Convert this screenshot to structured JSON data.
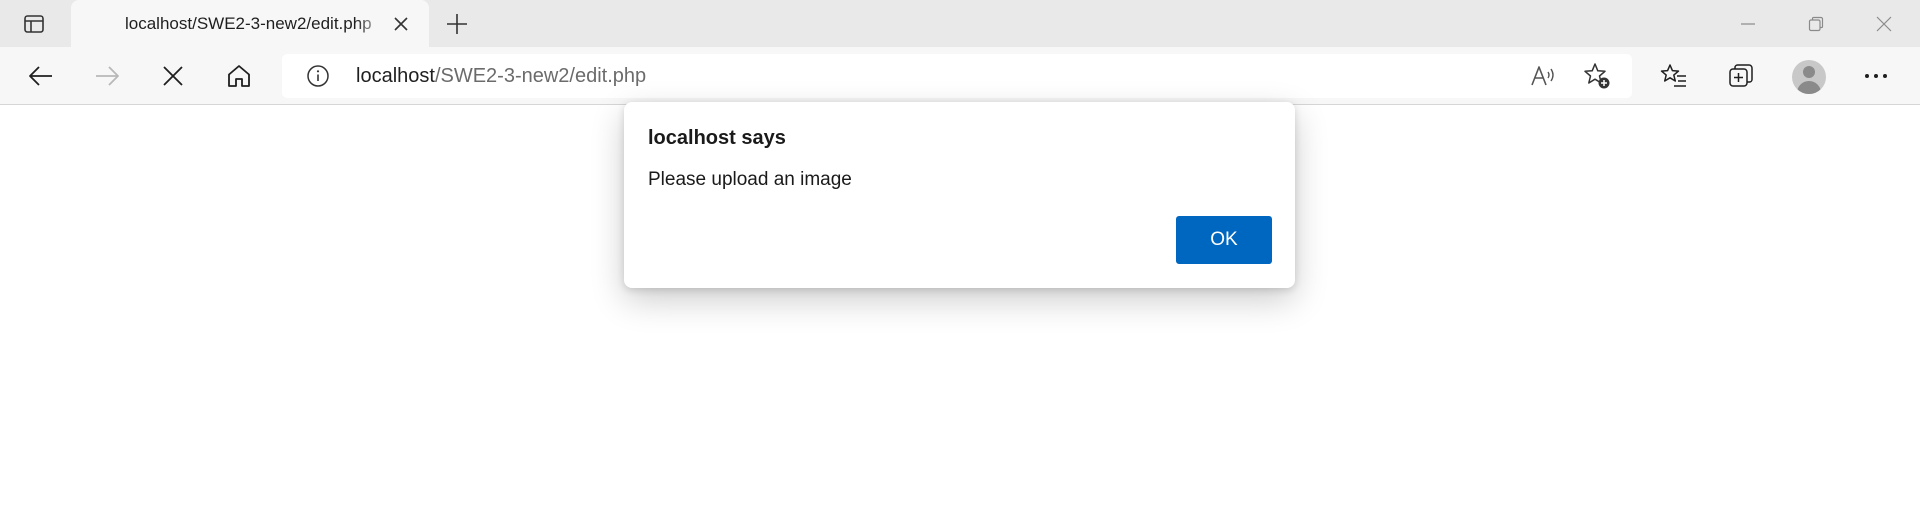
{
  "tab": {
    "title": "localhost/SWE2-3-new2/edit.php"
  },
  "address_bar": {
    "host": "localhost",
    "path": "/SWE2-3-new2/edit.php"
  },
  "dialog": {
    "title": "localhost says",
    "message": "Please upload an image",
    "ok_label": "OK"
  },
  "theme": {
    "primary_button": "#0067c0",
    "tabstrip_bg": "#e9e9e9",
    "toolbar_bg": "#f7f7f7"
  },
  "icons": {
    "tab_actions": "tab-actions-icon",
    "tab_close": "close-icon",
    "new_tab": "plus-icon",
    "minimize": "minimize-icon",
    "restore": "restore-icon",
    "window_close": "close-icon",
    "back": "back-arrow-icon",
    "forward": "forward-arrow-icon",
    "stop": "stop-icon",
    "home": "home-icon",
    "site_info": "info-icon",
    "read_aloud": "read-aloud-icon",
    "add_favorite": "star-add-icon",
    "favorites": "favorites-icon",
    "collections": "collections-icon",
    "profile": "profile-avatar",
    "menu": "more-icon"
  }
}
